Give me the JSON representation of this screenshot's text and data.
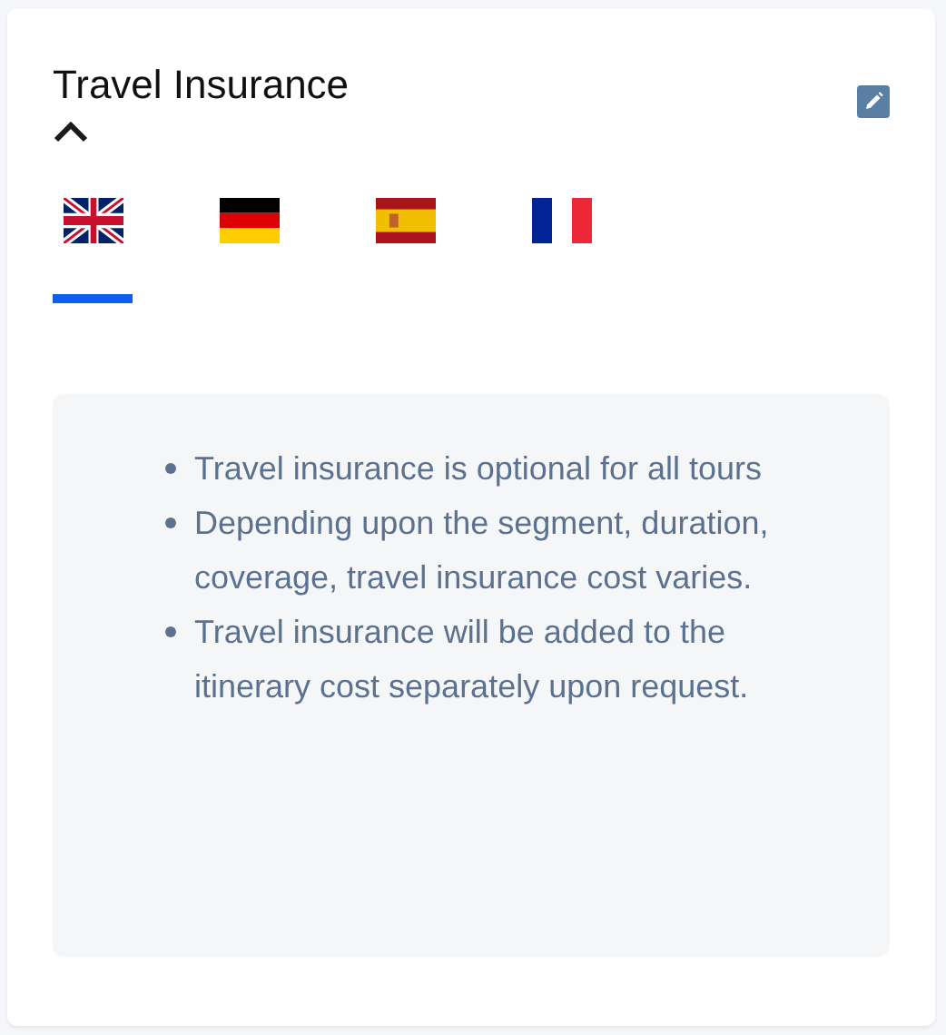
{
  "card": {
    "title": "Travel Insurance",
    "expanded": true
  },
  "tabs": [
    {
      "kind": "uk",
      "selected": true
    },
    {
      "kind": "de",
      "selected": false
    },
    {
      "kind": "es",
      "selected": false
    },
    {
      "kind": "fr",
      "selected": false
    }
  ],
  "notes": [
    "Travel insurance is optional for all tours",
    "Depending upon the segment, duration, coverage, travel insurance cost varies.",
    "Travel insurance will be added to the itinerary cost separately upon request."
  ]
}
